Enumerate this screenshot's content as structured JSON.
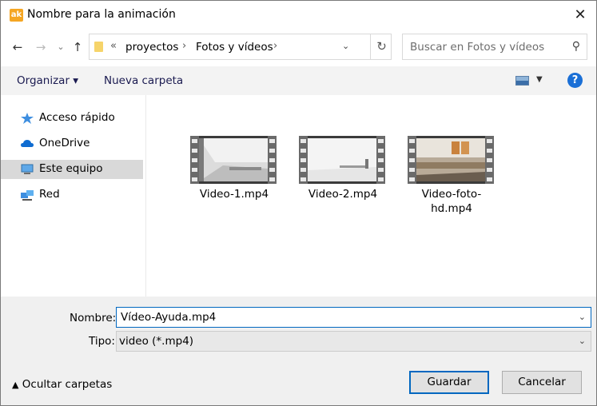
{
  "window": {
    "app_icon_text": "ak",
    "title": "Nombre para la animación",
    "close": "✕"
  },
  "nav": {
    "back": "←",
    "forward": "→",
    "recent": "⌄",
    "up": "↑"
  },
  "address": {
    "overflow": "«",
    "crumbs": [
      "proyectos",
      "Fotos y vídeos"
    ],
    "separator": "›",
    "dropdown": "⌄",
    "refresh": "↻"
  },
  "search": {
    "placeholder": "Buscar en Fotos y vídeos",
    "icon": "⚲"
  },
  "toolbar": {
    "organize": "Organizar ▾",
    "new_folder": "Nueva carpeta",
    "view_drop": "▼",
    "help": "?"
  },
  "sidebar": {
    "items": [
      {
        "label": "Acceso rápido",
        "icon": "star-icon",
        "selected": false
      },
      {
        "label": "OneDrive",
        "icon": "cloud-icon",
        "selected": false
      },
      {
        "label": "Este equipo",
        "icon": "computer-icon",
        "selected": true
      },
      {
        "label": "Red",
        "icon": "network-icon",
        "selected": false
      }
    ]
  },
  "files": [
    {
      "name": "Video-1.mp4"
    },
    {
      "name": "Video-2.mp4"
    },
    {
      "name": "Video-foto-hd.mp4"
    }
  ],
  "form": {
    "name_label": "Nombre:",
    "name_value": "Vídeo-Ayuda.mp4",
    "type_label": "Tipo:",
    "type_value": "video (*.mp4)",
    "dropdown": "⌄"
  },
  "footer": {
    "hide_folders": "Ocultar carpetas",
    "save": "Guardar",
    "cancel": "Cancelar"
  },
  "colors": {
    "accent": "#0067c0",
    "selected_bg": "#d9d9d9"
  }
}
